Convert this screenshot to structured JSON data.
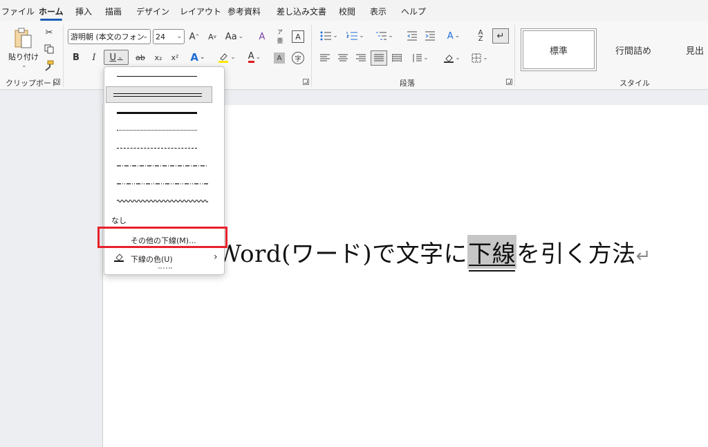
{
  "menu_tabs": [
    "ファイル",
    "ホーム",
    "挿入",
    "描画",
    "デザイン",
    "レイアウト",
    "参考資料",
    "差し込み文書",
    "校閲",
    "表示",
    "ヘルプ"
  ],
  "active_tab": "ホーム",
  "clipboard": {
    "paste_label": "貼り付け",
    "group_label": "クリップボード"
  },
  "font": {
    "font_name": "游明朝 (本文のフォン",
    "font_size": "24",
    "bold": "B",
    "italic": "I",
    "underline": "U",
    "strikethrough": "ab",
    "subscript": "x₂",
    "superscript": "x²",
    "change_case": "Aa",
    "grow_font": "A",
    "shrink_font": "A"
  },
  "paragraph": {
    "group_label": "段落"
  },
  "styles": {
    "group_label": "スタイル",
    "items": [
      "標準",
      "行間詰め",
      "見出"
    ]
  },
  "document": {
    "text_before": "Word(ワード)で文字に",
    "text_highlighted": "下線",
    "text_after": "を引く方法",
    "paragraph_mark": "↵"
  },
  "underline_menu": {
    "none_label": "なし",
    "more_underlines": "その他の下線(M)...",
    "underline_color": "下線の色(U)",
    "submenu_arrow": "›"
  },
  "colors": {
    "accent_tab": "#1b5fb5",
    "highlight_box": "#e8202a",
    "selection_bg": "#c6c6c6"
  }
}
